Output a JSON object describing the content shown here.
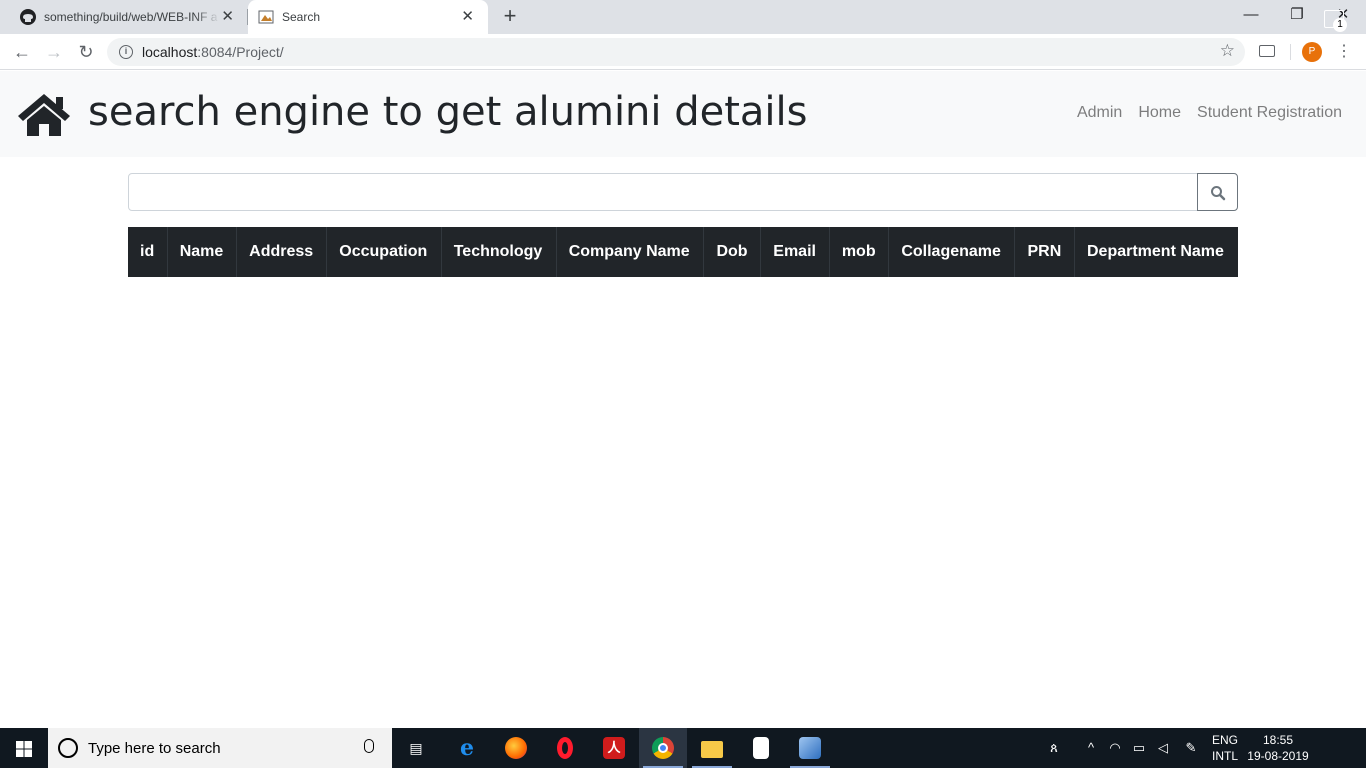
{
  "browser": {
    "tabs": [
      {
        "title": "something/build/web/WEB-INF a",
        "icon": "github-icon",
        "active": false
      },
      {
        "title": "Search",
        "icon": "page-icon",
        "active": true
      }
    ],
    "url_host": "localhost",
    "url_rest": ":8084/Project/",
    "profile_initial": "P",
    "window_buttons": {
      "minimize": "—",
      "restore": "❐",
      "close": "✕"
    }
  },
  "page": {
    "brand": "search engine to get alumini details",
    "nav": [
      "Admin",
      "Home",
      "Student Registration"
    ],
    "search": {
      "value": "",
      "placeholder": ""
    },
    "table": {
      "headers": [
        "id",
        "Name",
        "Address",
        "Occupation",
        "Technology",
        "Company Name",
        "Dob",
        "Email",
        "mob",
        "Collagename",
        "PRN",
        "Department Name"
      ],
      "rows": []
    }
  },
  "taskbar": {
    "search_placeholder": "Type here to search",
    "apps": [
      "task-view",
      "edge",
      "firefox",
      "opera",
      "acrobat",
      "chrome",
      "file-explorer",
      "notepad",
      "virtualbox"
    ],
    "lang_top": "ENG",
    "lang_bottom": "INTL",
    "time": "18:55",
    "date": "19-08-2019",
    "notification_count": "1"
  },
  "colors": {
    "navbar_bg": "#f8f9fa",
    "table_head_bg": "#212529",
    "taskbar_bg": "#101820",
    "profile": "#e8710a"
  }
}
